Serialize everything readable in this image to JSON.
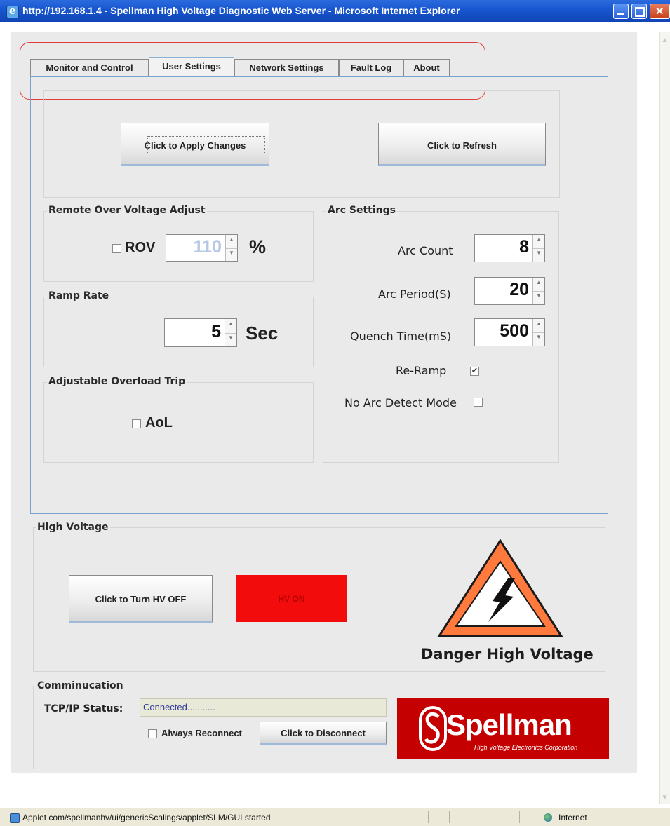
{
  "window": {
    "title": "http://192.168.1.4 - Spellman High Voltage Diagnostic Web Server - Microsoft Internet Explorer"
  },
  "tabs": [
    {
      "label": "Monitor and Control",
      "active": false
    },
    {
      "label": "User Settings",
      "active": true
    },
    {
      "label": "Network Settings",
      "active": false
    },
    {
      "label": "Fault Log",
      "active": false
    },
    {
      "label": "About",
      "active": false
    }
  ],
  "actions": {
    "apply_label": "Click to Apply Changes",
    "refresh_label": "Click to Refresh"
  },
  "rov": {
    "group_title": "Remote Over Voltage Adjust",
    "checkbox_label": "ROV",
    "checked": false,
    "value": "110",
    "unit": "%"
  },
  "ramp": {
    "group_title": "Ramp Rate",
    "value": "5",
    "unit": "Sec"
  },
  "aol": {
    "group_title": "Adjustable Overload Trip",
    "checkbox_label": "AoL",
    "checked": false
  },
  "arc": {
    "group_title": "Arc Settings",
    "count_label": "Arc Count",
    "count_value": "8",
    "period_label": "Arc Period(S)",
    "period_value": "20",
    "quench_label": "Quench Time(mS)",
    "quench_value": "500",
    "reramp_label": "Re-Ramp",
    "reramp_checked": true,
    "noarc_label": "No Arc Detect Mode",
    "noarc_checked": false
  },
  "hv": {
    "group_title": "High Voltage",
    "button_label": "Click to Turn HV OFF",
    "indicator_label": "HV ON",
    "indicator_color": "#f20c0c",
    "warning_icon": "danger-triangle-icon",
    "warning_text": "Danger High Voltage"
  },
  "comm": {
    "group_title": "Comminucation",
    "status_label": "TCP/IP Status:",
    "status_value": "Connected...........",
    "always_reconnect_label": "Always Reconnect",
    "always_reconnect_checked": false,
    "disconnect_label": "Click to Disconnect"
  },
  "logo": {
    "brand": "Spellman",
    "tagline": "High Voltage Electronics Corporation",
    "background_color": "#c40000"
  },
  "statusbar": {
    "message": "Applet com/spellmanhv/ui/genericScalings/applet/SLM/GUI started",
    "zone": "Internet"
  }
}
